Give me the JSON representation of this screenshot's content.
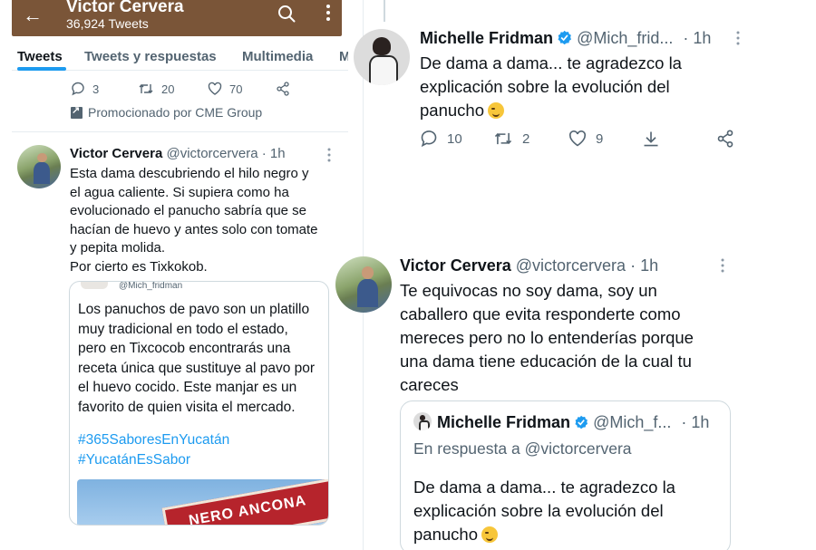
{
  "left": {
    "topbar": {
      "name": "Victor Cervera",
      "tweet_count": "36,924 Tweets",
      "color": "#7a5538"
    },
    "tabs": [
      {
        "label": "Tweets",
        "active": true
      },
      {
        "label": "Tweets y respuestas",
        "active": false
      },
      {
        "label": "Multimedia",
        "active": false
      },
      {
        "label": "M",
        "active": false
      }
    ],
    "prev_tweet_actions": {
      "replies": "3",
      "retweets": "20",
      "likes": "70"
    },
    "promoted_label": "Promocionado por CME Group",
    "tweet": {
      "name": "Victor Cervera",
      "handle": "@victorcervera",
      "time": "· 1h",
      "text_lines": [
        "Esta dama descubriendo el hilo negro y",
        "el agua caliente. Si supiera como ha",
        "evolucionado el panucho sabría que se",
        "hacían de huevo y antes solo con tomate",
        "y pepita molida.",
        "Por cierto es Tixkokob."
      ]
    },
    "quoted": {
      "handle": "@Mich_fridman",
      "text_lines": [
        "Los panuchos de pavo son un platillo",
        "muy tradicional en todo el estado,",
        "pero en Tixcocob encontrarás una",
        "receta única que sustituye al pavo por",
        "el huevo cocido. Este manjar es un",
        "favorito de quien visita el mercado."
      ],
      "hashtags": [
        "#365SaboresEnYucatán",
        "#YucatánEsSabor"
      ],
      "image_sign_text": "NERO ANCONA"
    }
  },
  "right": {
    "michelle_tweet": {
      "name": "Michelle Fridman",
      "handle": "@Mich_frid...",
      "time": "· 1h",
      "text_lines": [
        "De dama a dama... te agradezco la",
        "explicación sobre la evolución del",
        "panucho"
      ],
      "replies": "10",
      "retweets": "2",
      "likes": "9"
    },
    "victor_reply": {
      "name": "Victor Cervera",
      "handle": "@victorcervera",
      "time": "· 1h",
      "text_lines": [
        "Te equivocas no soy dama, soy un",
        "caballero que evita responderte como",
        "mereces pero no lo entenderías porque",
        "una dama tiene educación de la cual tu",
        "careces"
      ]
    },
    "quoted": {
      "name": "Michelle Fridman",
      "handle": "@Mich_f...",
      "time": "· 1h",
      "reply_to": "En respuesta a @victorcervera",
      "text_lines": [
        "De dama a dama... te agradezco la",
        "explicación sobre la evolución del",
        "panucho"
      ]
    }
  },
  "colors": {
    "accent": "#1d9bf0",
    "muted": "#536471",
    "border": "#cfd9de"
  }
}
